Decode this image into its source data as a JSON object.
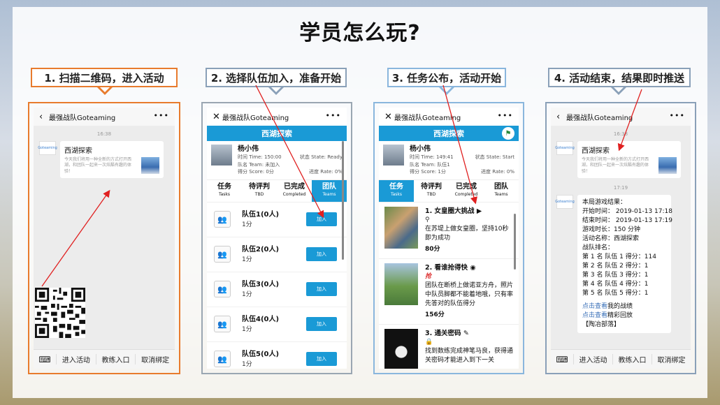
{
  "title": "学员怎么玩?",
  "steps": [
    {
      "label": "1. 扫描二维码，进入活动",
      "color": "#e87b2d"
    },
    {
      "label": "2. 选择队伍加入，准备开始",
      "color": "#8aa0b8"
    },
    {
      "label": "3. 任务公布，活动开始",
      "color": "#8ab6dd"
    },
    {
      "label": "4. 活动结束，结果即时推送",
      "color": "#8aa0b8"
    }
  ],
  "app_name": "最强战队Goteaming",
  "time1": "16:38",
  "time2": "17:19",
  "avatar_text": "Goteaming",
  "card": {
    "title": "西湖探索",
    "desc": "今天我们将用一种全新的方式打开西湖，和团队一起来一次炫酷有趣的体验！"
  },
  "bottom": {
    "items": [
      "进入活动",
      "教练入口",
      "取消绑定"
    ]
  },
  "activity": "西湖探索",
  "p2": {
    "name": "杨小伟",
    "time": "时间 Time:  150:00",
    "state": "状态 State:  Ready",
    "team": "队名 Team:  未加入",
    "score": "得分 Score:  0分",
    "progress": "进度 Rate:  0%"
  },
  "p3": {
    "name": "杨小伟",
    "time": "时间 Time:  149:41",
    "state": "状态 State:  Start",
    "team": "队名 Team:  队伍1",
    "score": "得分 Score:  1分",
    "progress": "进度 Rate:  0%"
  },
  "tabs": [
    {
      "zh": "任务",
      "en": "Tasks"
    },
    {
      "zh": "待评判",
      "en": "TBD"
    },
    {
      "zh": "已完成",
      "en": "Completed"
    },
    {
      "zh": "团队",
      "en": "Teams"
    }
  ],
  "teams": [
    {
      "name": "队伍1(0人)",
      "score": "1分"
    },
    {
      "name": "队伍2(0人)",
      "score": "1分"
    },
    {
      "name": "队伍3(0人)",
      "score": "1分"
    },
    {
      "name": "队伍4(0人)",
      "score": "1分"
    },
    {
      "name": "队伍5(0人)",
      "score": "1分"
    }
  ],
  "join_label": "加入",
  "tasks": [
    {
      "title": "1. 女皇圈大挑战",
      "desc": "在苏堤上做女皇圈，坚持10秒即为成功",
      "points": "80分"
    },
    {
      "title": "2. 看谁抢得快",
      "tag": "抢",
      "desc": "团队在断桥上做诺亚方舟，照片中队员脚都不能着地哦，只有率先答对的队伍得分",
      "points": "156分"
    },
    {
      "title": "3. 通关密码",
      "desc": "找到数练完成神笔马良，获得通关密码才能进入到下一关"
    }
  ],
  "results": [
    "本局游戏结果：",
    "开始时间：  2019-01-13 17:18",
    "结束时间：  2019-01-13 17:19",
    "游戏时长：150 分钟",
    "活动名称：西湖探索",
    "战队排名：",
    "第 1 名    队伍 1   得分：114",
    "第 2 名    队伍 2   得分：1",
    "第 3 名    队伍 3   得分：1",
    "第 4 名    队伍 4   得分：1",
    "第 5 名    队伍 5   得分：1"
  ],
  "links": [
    {
      "link": "点击查看",
      "rest": "我的战绩"
    },
    {
      "link": "点击查看",
      "rest": "精彩回放"
    }
  ],
  "footer_tag": "【陶冶部落】"
}
